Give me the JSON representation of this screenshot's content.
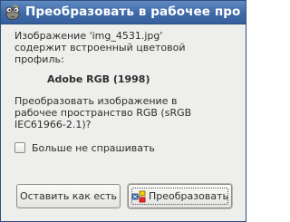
{
  "window": {
    "title": "Преобразовать в рабочее про"
  },
  "message": {
    "line1": "Изображение 'img_4531.jpg'",
    "line2": "содержит встроенный цветовой",
    "line3": "профиль:",
    "profile": "Adobe RGB (1998)",
    "question1": "Преобразовать изображение в",
    "question2": "рабочее пространство RGB (sRGB",
    "question3": "IEC61966-2.1)?"
  },
  "checkbox": {
    "label": "Больше не спрашивать",
    "checked": false
  },
  "buttons": {
    "keep": "Оставить как есть",
    "convert": "Преобразовать"
  },
  "icons": {
    "title": "gimp-icon",
    "convert": "convert-icon"
  }
}
